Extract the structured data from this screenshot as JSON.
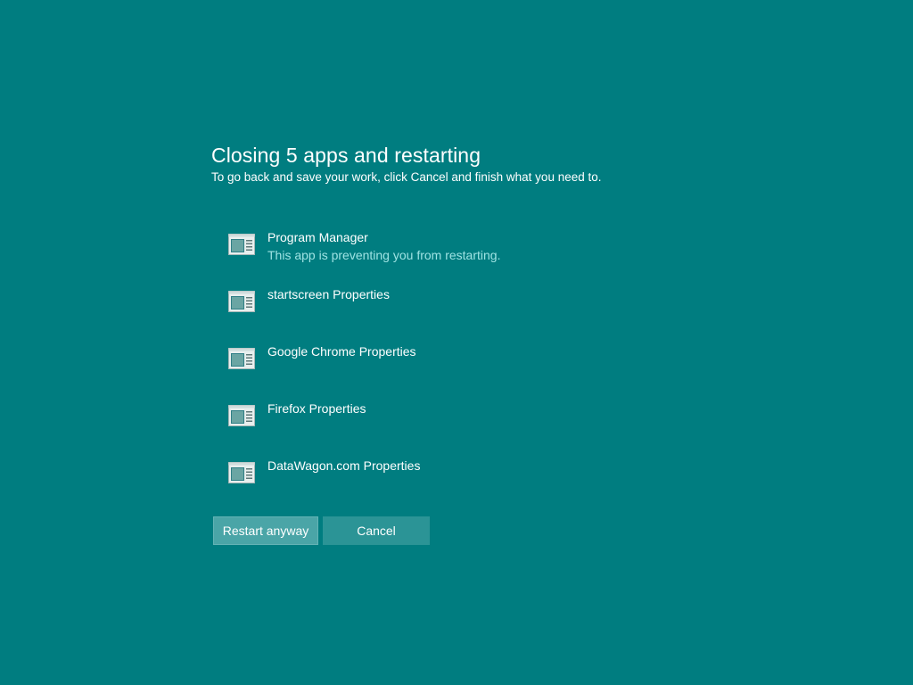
{
  "dialog": {
    "title": "Closing 5 apps and restarting",
    "subtitle": "To go back and save your work, click Cancel and finish what you need to."
  },
  "apps": [
    {
      "name": "Program Manager",
      "note": "This app is preventing you from restarting."
    },
    {
      "name": "startscreen Properties",
      "note": ""
    },
    {
      "name": "Google Chrome Properties",
      "note": ""
    },
    {
      "name": "Firefox Properties",
      "note": ""
    },
    {
      "name": "DataWagon.com Properties",
      "note": ""
    }
  ],
  "buttons": {
    "restart_label": "Restart anyway",
    "cancel_label": "Cancel"
  },
  "colors": {
    "background": "#007d80",
    "note_text": "#9fe3e3",
    "restart_button": "#4aa5a7",
    "cancel_button": "#2b9496"
  },
  "icons": {
    "app_icon": "window-app-icon"
  }
}
